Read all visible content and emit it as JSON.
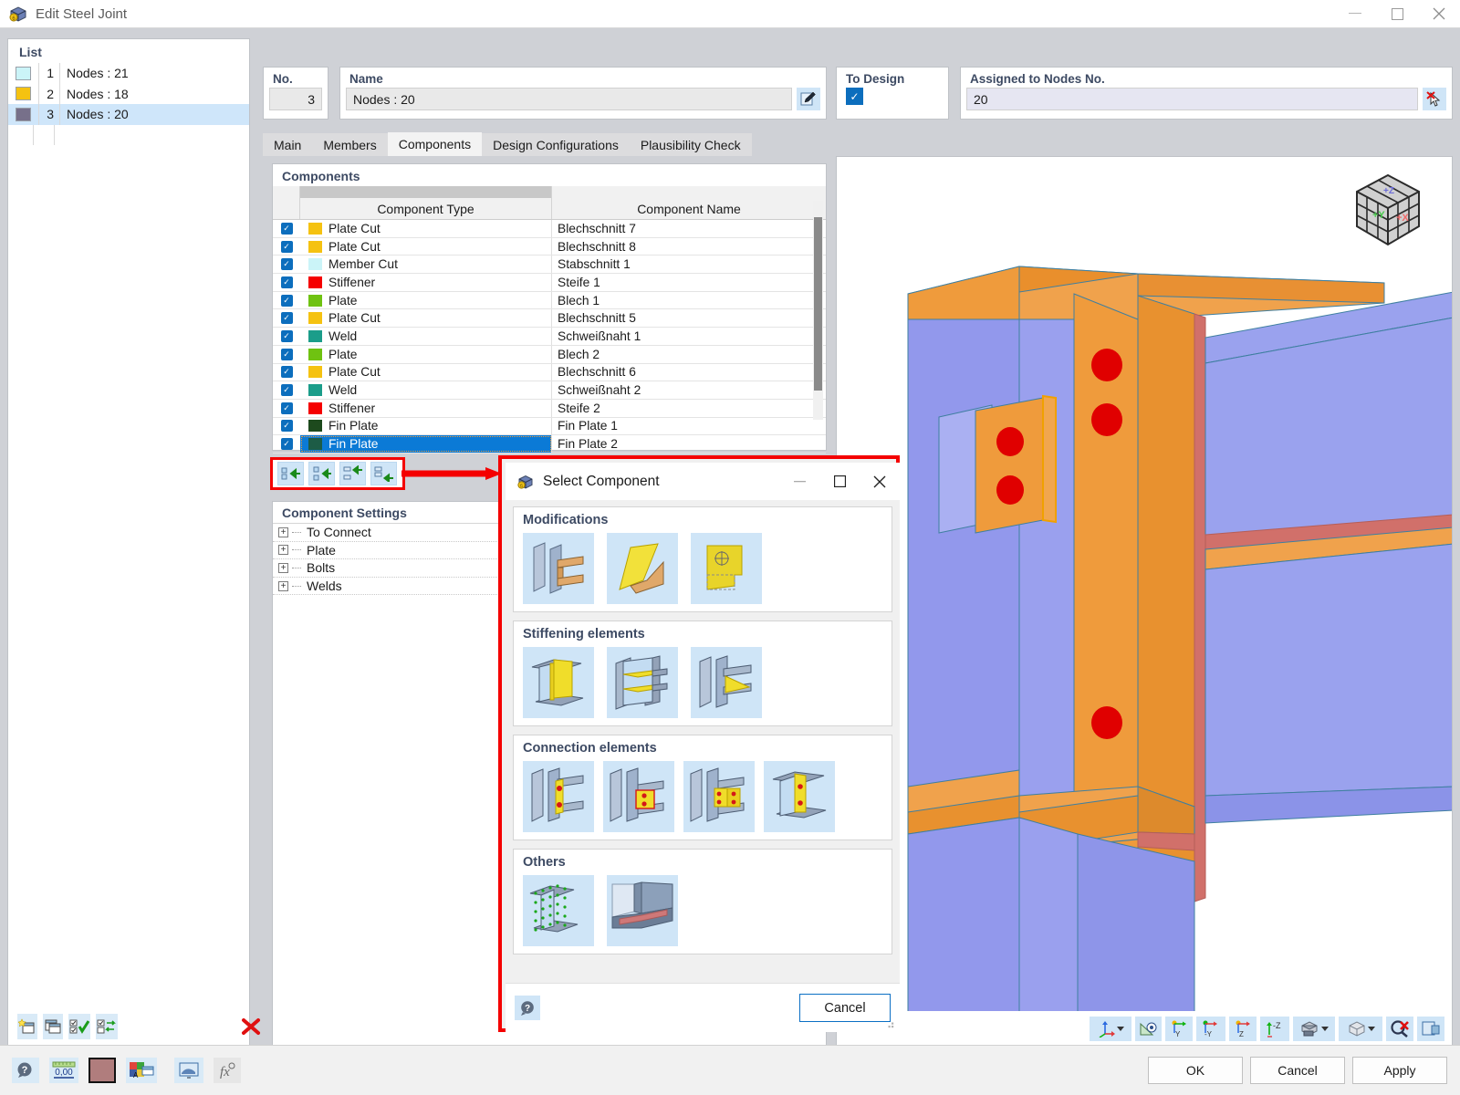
{
  "window": {
    "title": "Edit Steel Joint",
    "icon": "steel-joint-icon",
    "minimize": "–",
    "maximize": "□",
    "close": "✕"
  },
  "list_panel": {
    "title": "List",
    "items": [
      {
        "num": "1",
        "label": "Nodes : 21",
        "color": "#cbf4f8",
        "selected": false
      },
      {
        "num": "2",
        "label": "Nodes : 18",
        "color": "#f5c211",
        "selected": false
      },
      {
        "num": "3",
        "label": "Nodes : 20",
        "color": "#77708a",
        "selected": true
      }
    ],
    "toolbar": [
      {
        "name": "new-joint-button",
        "glyph": "new"
      },
      {
        "name": "copy-joint-button",
        "glyph": "copy"
      },
      {
        "name": "select-all-button",
        "glyph": "checkall"
      },
      {
        "name": "invert-selection-button",
        "glyph": "invert"
      },
      {
        "name": "delete-joint-button",
        "glyph": "delete"
      }
    ]
  },
  "header": {
    "no_label": "No.",
    "no_value": "3",
    "name_label": "Name",
    "name_value": "Nodes : 20",
    "name_edit_icon": "edit-pencil-icon",
    "to_design_label": "To Design",
    "to_design_checked": true,
    "nodes_label": "Assigned to Nodes No.",
    "nodes_value": "20",
    "nodes_pick_icon": "pick-cursor-icon"
  },
  "tabs": [
    {
      "label": "Main",
      "active": false
    },
    {
      "label": "Members",
      "active": false
    },
    {
      "label": "Components",
      "active": true
    },
    {
      "label": "Design Configurations",
      "active": false
    },
    {
      "label": "Plausibility Check",
      "active": false
    }
  ],
  "components_panel": {
    "title": "Components",
    "columns": [
      "Component Type",
      "Component Name"
    ],
    "rows": [
      {
        "checked": true,
        "color": "#f5c211",
        "type": "Plate Cut",
        "name": "Blechschnitt 7",
        "selected": false
      },
      {
        "checked": true,
        "color": "#f5c211",
        "type": "Plate Cut",
        "name": "Blechschnitt 8",
        "selected": false
      },
      {
        "checked": true,
        "color": "#cbf4f8",
        "type": "Member Cut",
        "name": "Stabschnitt 1",
        "selected": false
      },
      {
        "checked": true,
        "color": "#f50000",
        "type": "Stiffener",
        "name": "Steife 1",
        "selected": false
      },
      {
        "checked": true,
        "color": "#6fc211",
        "type": "Plate",
        "name": "Blech 1",
        "selected": false
      },
      {
        "checked": true,
        "color": "#f5c211",
        "type": "Plate Cut",
        "name": "Blechschnitt 5",
        "selected": false
      },
      {
        "checked": true,
        "color": "#1b9d8a",
        "type": "Weld",
        "name": "Schweißnaht 1",
        "selected": false
      },
      {
        "checked": true,
        "color": "#6fc211",
        "type": "Plate",
        "name": "Blech 2",
        "selected": false
      },
      {
        "checked": true,
        "color": "#f5c211",
        "type": "Plate Cut",
        "name": "Blechschnitt 6",
        "selected": false
      },
      {
        "checked": true,
        "color": "#1b9d8a",
        "type": "Weld",
        "name": "Schweißnaht 2",
        "selected": false
      },
      {
        "checked": true,
        "color": "#f50000",
        "type": "Stiffener",
        "name": "Steife 2",
        "selected": false
      },
      {
        "checked": true,
        "color": "#1d4a1d",
        "type": "Fin Plate",
        "name": "Fin Plate 1",
        "selected": false
      },
      {
        "checked": true,
        "color": "#1d5c46",
        "type": "Fin Plate",
        "name": "Fin Plate 2",
        "selected": true
      }
    ]
  },
  "component_toolbar": {
    "highlighted": true,
    "buttons": [
      {
        "name": "add-component-button"
      },
      {
        "name": "insert-component-button"
      },
      {
        "name": "move-up-component-button"
      },
      {
        "name": "move-down-component-button"
      }
    ]
  },
  "settings_panel": {
    "title": "Component Settings",
    "tree": [
      {
        "label": "To Connect",
        "expanded": false
      },
      {
        "label": "Plate",
        "expanded": false
      },
      {
        "label": "Bolts",
        "expanded": false
      },
      {
        "label": "Welds",
        "expanded": false
      }
    ]
  },
  "viewport": {
    "nav_cube": "navigation-cube",
    "nav_cube_axes": {
      "x": "+X",
      "y": "+Y",
      "z": "+Z"
    },
    "origin_axis_label": "Y",
    "model_colors": {
      "column_flange": "#8b93e8",
      "beam_web": "#9aa2ee",
      "plate_orange": "#ef9b3c",
      "bolt_red": "#e00000",
      "weld_red": "#d1706a"
    },
    "toolbar": [
      {
        "name": "coordinate-system-button",
        "glyph": "axes",
        "dropdown": true
      },
      {
        "name": "view-plane-button",
        "glyph": "plane-eye"
      },
      {
        "name": "view-x-button",
        "glyph": "axis-y"
      },
      {
        "name": "view-negy-button",
        "glyph": "axis-negy"
      },
      {
        "name": "view-z-button",
        "glyph": "axis-z"
      },
      {
        "name": "view-negz-button",
        "glyph": "axis-negz"
      },
      {
        "name": "render-mode-button",
        "glyph": "solid",
        "dropdown": true
      },
      {
        "name": "display-style-button",
        "glyph": "wireframe-box",
        "dropdown": true
      },
      {
        "name": "reset-view-button",
        "glyph": "zoom-reset"
      },
      {
        "name": "print-view-button",
        "glyph": "print"
      }
    ]
  },
  "bottom_bar": {
    "icons": [
      {
        "name": "help-button",
        "glyph": "help"
      },
      {
        "name": "units-button",
        "glyph": "units"
      },
      {
        "name": "color-button",
        "glyph": "color"
      },
      {
        "name": "render-settings-button",
        "glyph": "render"
      },
      {
        "name": "view-settings-button",
        "glyph": "viewsettings"
      },
      {
        "name": "formula-button",
        "glyph": "formula",
        "disabled": true
      }
    ],
    "buttons": [
      {
        "label": "OK",
        "name": "ok-button"
      },
      {
        "label": "Cancel",
        "name": "cancel-button"
      },
      {
        "label": "Apply",
        "name": "apply-button"
      }
    ]
  },
  "dialog": {
    "title": "Select Component",
    "icon": "steel-joint-icon",
    "minimize": "–",
    "maximize": "□",
    "close": "✕",
    "groups": [
      {
        "title": "Modifications",
        "items": [
          {
            "name": "member-cut-thumbnail"
          },
          {
            "name": "plate-cut-thumbnail"
          },
          {
            "name": "plate-opening-thumbnail"
          }
        ]
      },
      {
        "title": "Stiffening elements",
        "items": [
          {
            "name": "stiffener-thumbnail"
          },
          {
            "name": "horizontal-stiffener-thumbnail"
          },
          {
            "name": "haunch-thumbnail"
          }
        ]
      },
      {
        "title": "Connection elements",
        "items": [
          {
            "name": "end-plate-thumbnail"
          },
          {
            "name": "fin-plate-thumbnail"
          },
          {
            "name": "double-angle-thumbnail"
          },
          {
            "name": "splice-plate-thumbnail"
          }
        ]
      },
      {
        "title": "Others",
        "items": [
          {
            "name": "contact-surface-thumbnail"
          },
          {
            "name": "weld-thumbnail"
          }
        ]
      }
    ],
    "help_icon": "help-icon",
    "cancel_label": "Cancel"
  }
}
